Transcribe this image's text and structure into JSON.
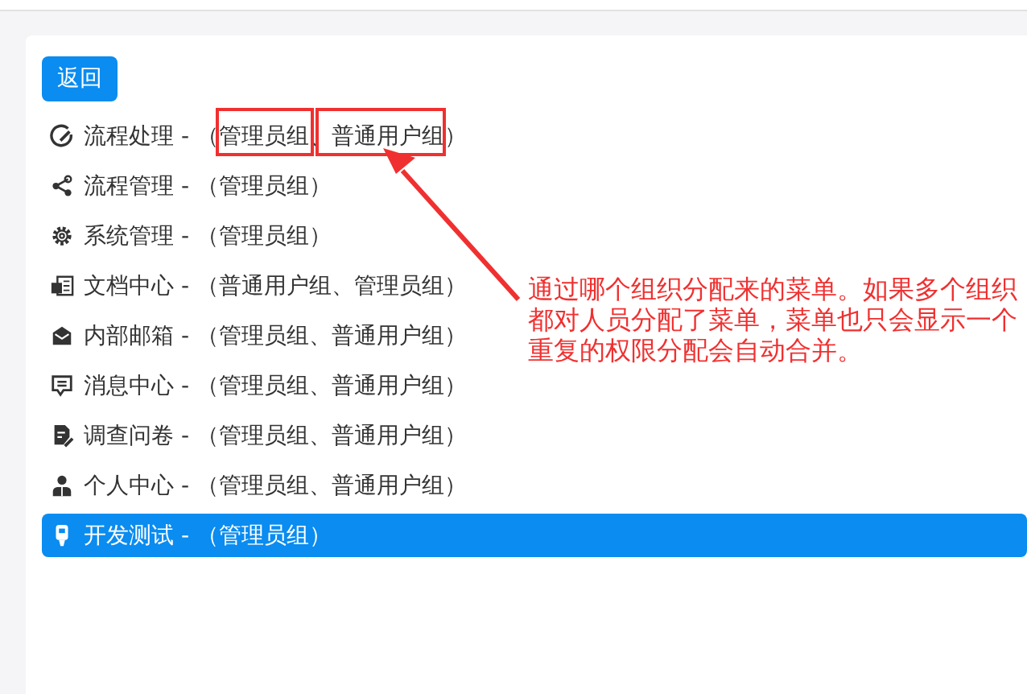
{
  "back_button": {
    "label": "返回"
  },
  "menu_items": [
    {
      "label": "流程处理 - （管理员组、普通用户组）",
      "selected": false
    },
    {
      "label": "流程管理 - （管理员组）",
      "selected": false
    },
    {
      "label": "系统管理 - （管理员组）",
      "selected": false
    },
    {
      "label": "文档中心 - （普通用户组、管理员组）",
      "selected": false
    },
    {
      "label": "内部邮箱 - （管理员组、普通用户组）",
      "selected": false
    },
    {
      "label": "消息中心 - （管理员组、普通用户组）",
      "selected": false
    },
    {
      "label": "调查问卷 - （管理员组、普通用户组）",
      "selected": false
    },
    {
      "label": "个人中心 - （管理员组、普通用户组）",
      "selected": false
    },
    {
      "label": "开发测试 - （管理员组）",
      "selected": true
    }
  ],
  "annotation": {
    "note": "通过哪个组织分配来的菜单。如果多个组织都对人员分配了菜单，菜单也只会显示一个重复的权限分配会自动合并。"
  }
}
